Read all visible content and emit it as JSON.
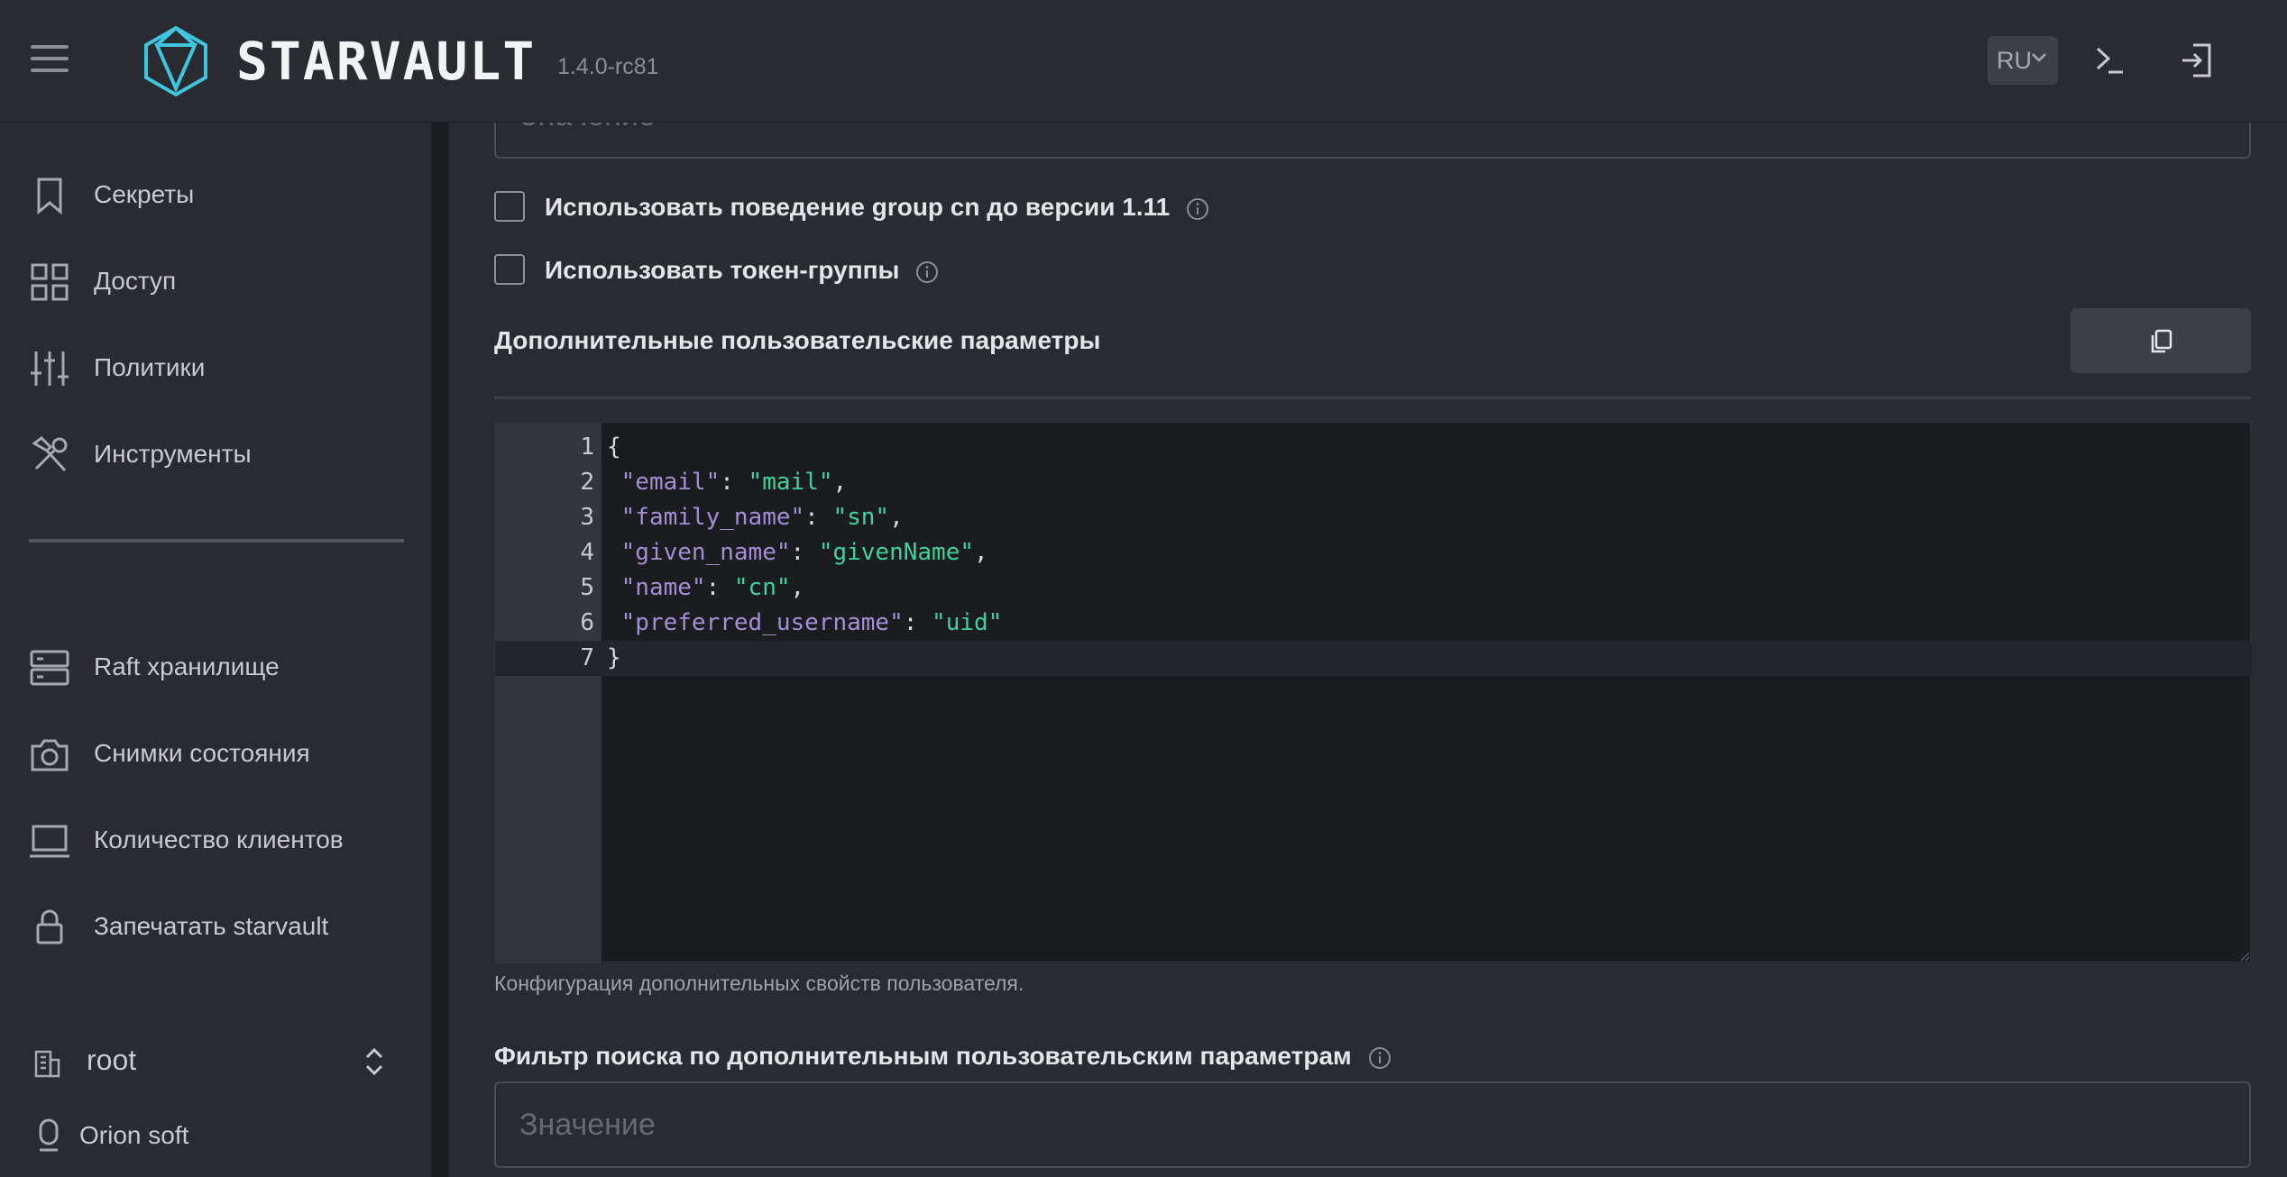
{
  "header": {
    "brand": "STARVAULT",
    "version": "1.4.0-rc81",
    "lang": "RU"
  },
  "sidebar": {
    "items": [
      {
        "label": "Секреты",
        "icon": "bookmark-icon"
      },
      {
        "label": "Доступ",
        "icon": "grid-icon"
      },
      {
        "label": "Политики",
        "icon": "sliders-icon"
      },
      {
        "label": "Инструменты",
        "icon": "tools-icon"
      },
      {
        "label": "Raft хранилище",
        "icon": "server-icon"
      },
      {
        "label": "Снимки состояния",
        "icon": "camera-icon"
      },
      {
        "label": "Количество клиентов",
        "icon": "laptop-icon"
      },
      {
        "label": "Запечатать starvault",
        "icon": "lock-icon"
      }
    ],
    "namespace": "root",
    "org": "Orion soft"
  },
  "main": {
    "top_input_placeholder": "Значение",
    "checkbox_group_cn": "Использовать поведение group cn до версии 1.11",
    "checkbox_token_groups": "Использовать токен-группы",
    "extra_params_title": "Дополнительные пользовательские параметры",
    "editor_lines": [
      {
        "n": "1",
        "text": "{"
      },
      {
        "n": "2",
        "key": "\"email\"",
        "val": "\"mail\"",
        "trail": ","
      },
      {
        "n": "3",
        "key": "\"family_name\"",
        "val": "\"sn\"",
        "trail": ","
      },
      {
        "n": "4",
        "key": "\"given_name\"",
        "val": "\"givenName\"",
        "trail": ","
      },
      {
        "n": "5",
        "key": "\"name\"",
        "val": "\"cn\"",
        "trail": ","
      },
      {
        "n": "6",
        "key": "\"preferred_username\"",
        "val": "\"uid\"",
        "trail": ""
      },
      {
        "n": "7",
        "text": "}"
      }
    ],
    "editor_hint": "Конфигурация дополнительных свойств пользователя.",
    "filter_title": "Фильтр поиска по дополнительным пользовательским параметрам",
    "filter_placeholder": "Значение"
  },
  "colors": {
    "json_key": "#a48ed6",
    "json_string": "#3fd29a",
    "logo_accent": "#3ec6e0"
  }
}
